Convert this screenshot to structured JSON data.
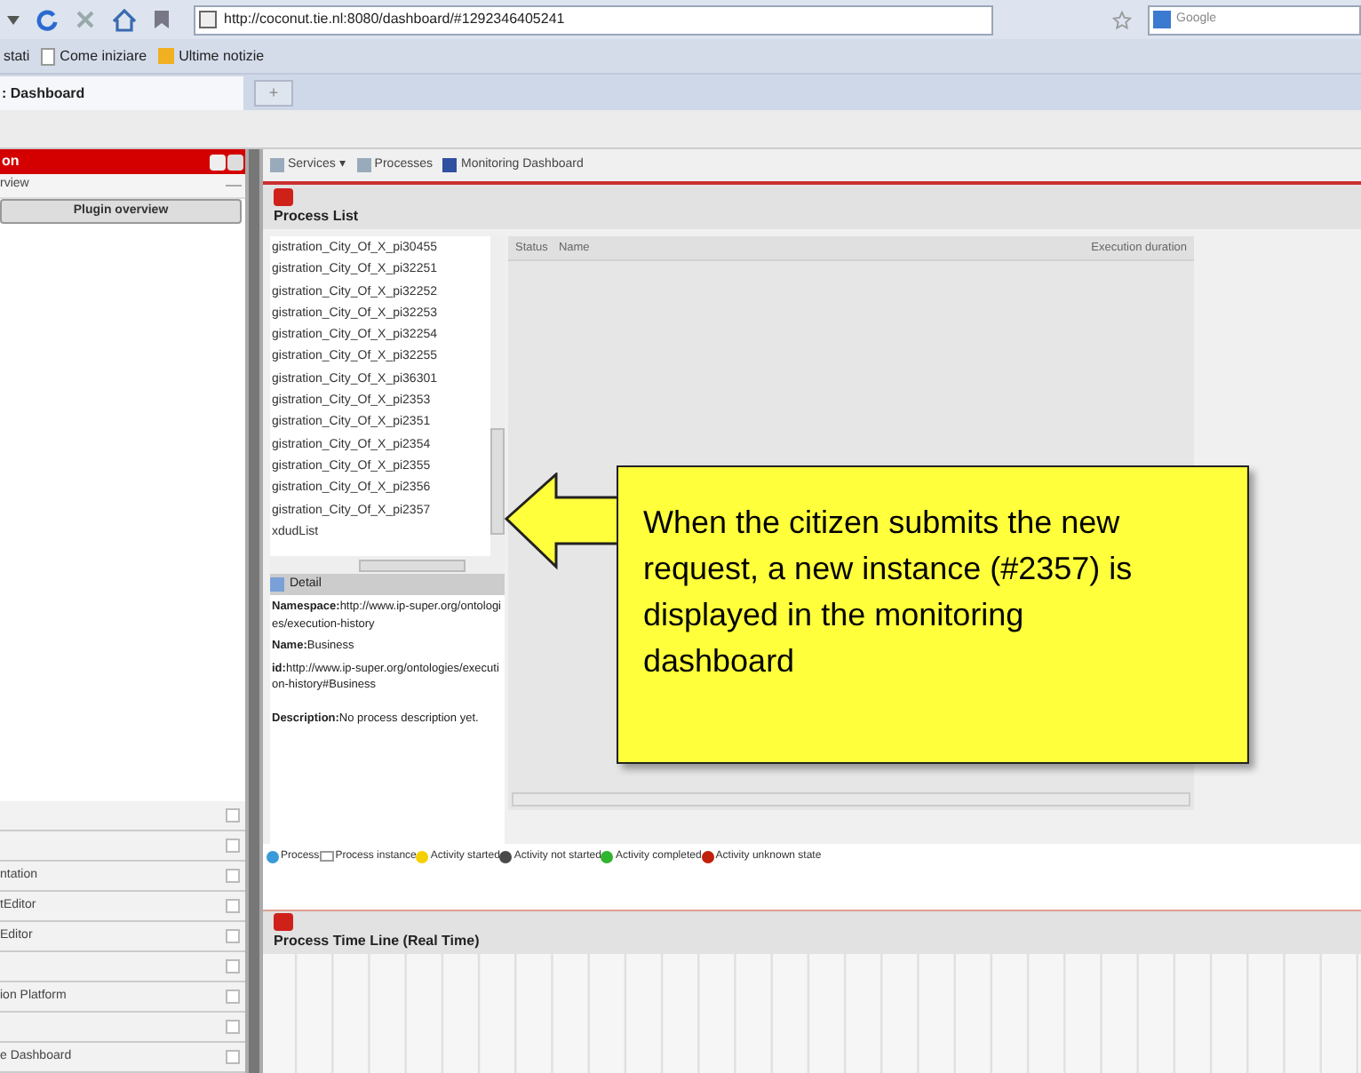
{
  "browser": {
    "url": "http://coconut.tie.nl:8080/dashboard/#1292346405241",
    "search_placeholder": "Google",
    "bookmarks": [
      "stati",
      "Come iniziare",
      "Ultime notizie"
    ],
    "tabs": [
      {
        "label": ": Dashboard",
        "selected": true
      }
    ],
    "new_tab": "+"
  },
  "sidebar": {
    "title": "on",
    "overview_label": "rview",
    "plugin_button": "Plugin overview",
    "sections": [
      {
        "kind": "blank"
      },
      {
        "kind": "blank"
      },
      {
        "kind": "titled",
        "label": "ntation"
      },
      {
        "kind": "titled",
        "label": "tEditor"
      },
      {
        "kind": "titled",
        "label": "Editor"
      },
      {
        "kind": "blank"
      },
      {
        "kind": "titled",
        "label": "ion Platform"
      },
      {
        "kind": "blank"
      },
      {
        "kind": "titled",
        "label": "e Dashboard"
      }
    ]
  },
  "toolbar": {
    "items": [
      "Services ▾",
      "Processes",
      "Monitoring Dashboard"
    ]
  },
  "process_list": {
    "title": "Process List",
    "items": [
      "gistration_City_Of_X_pi30455",
      "gistration_City_Of_X_pi32251",
      "gistration_City_Of_X_pi32252",
      "gistration_City_Of_X_pi32253",
      "gistration_City_Of_X_pi32254",
      "gistration_City_Of_X_pi32255",
      "gistration_City_Of_X_pi36301",
      "gistration_City_Of_X_pi2353",
      "gistration_City_Of_X_pi2351",
      "gistration_City_Of_X_pi2354",
      "gistration_City_Of_X_pi2355",
      "gistration_City_Of_X_pi2356",
      "gistration_City_Of_X_pi2357",
      "xdudList"
    ],
    "detail": {
      "title": "Detail",
      "fields": [
        {
          "label": "Namespace:",
          "value": "http://www.ip-super.org/ontologies/execution-history"
        },
        {
          "label": "Name:",
          "value": "Business"
        },
        {
          "label": "id:",
          "value": "http://www.ip-super.org/ontologies/execution-history#Business"
        },
        {
          "label": "Description:",
          "value": "No process description yet."
        }
      ]
    },
    "table": {
      "columns": [
        "Status",
        "Name",
        "Execution duration"
      ]
    },
    "legend": [
      {
        "label": "Process",
        "kind": "circle",
        "color": "#3a9ad9"
      },
      {
        "label": "Process instance",
        "kind": "box"
      },
      {
        "label": "Activity started",
        "kind": "circle",
        "color": "#f5d000"
      },
      {
        "label": "Activity not started",
        "kind": "circle",
        "color": "#4a4a4a"
      },
      {
        "label": "Activity completed",
        "kind": "circle",
        "color": "#2fb52f"
      },
      {
        "label": "Activity unknown state",
        "kind": "circle",
        "color": "#c0200c"
      }
    ]
  },
  "timeline": {
    "title": "Process Time Line (Real Time)"
  },
  "callout": {
    "text": "When the citizen submits the new request, a new instance (#2357) is displayed in the monitoring dashboard"
  }
}
